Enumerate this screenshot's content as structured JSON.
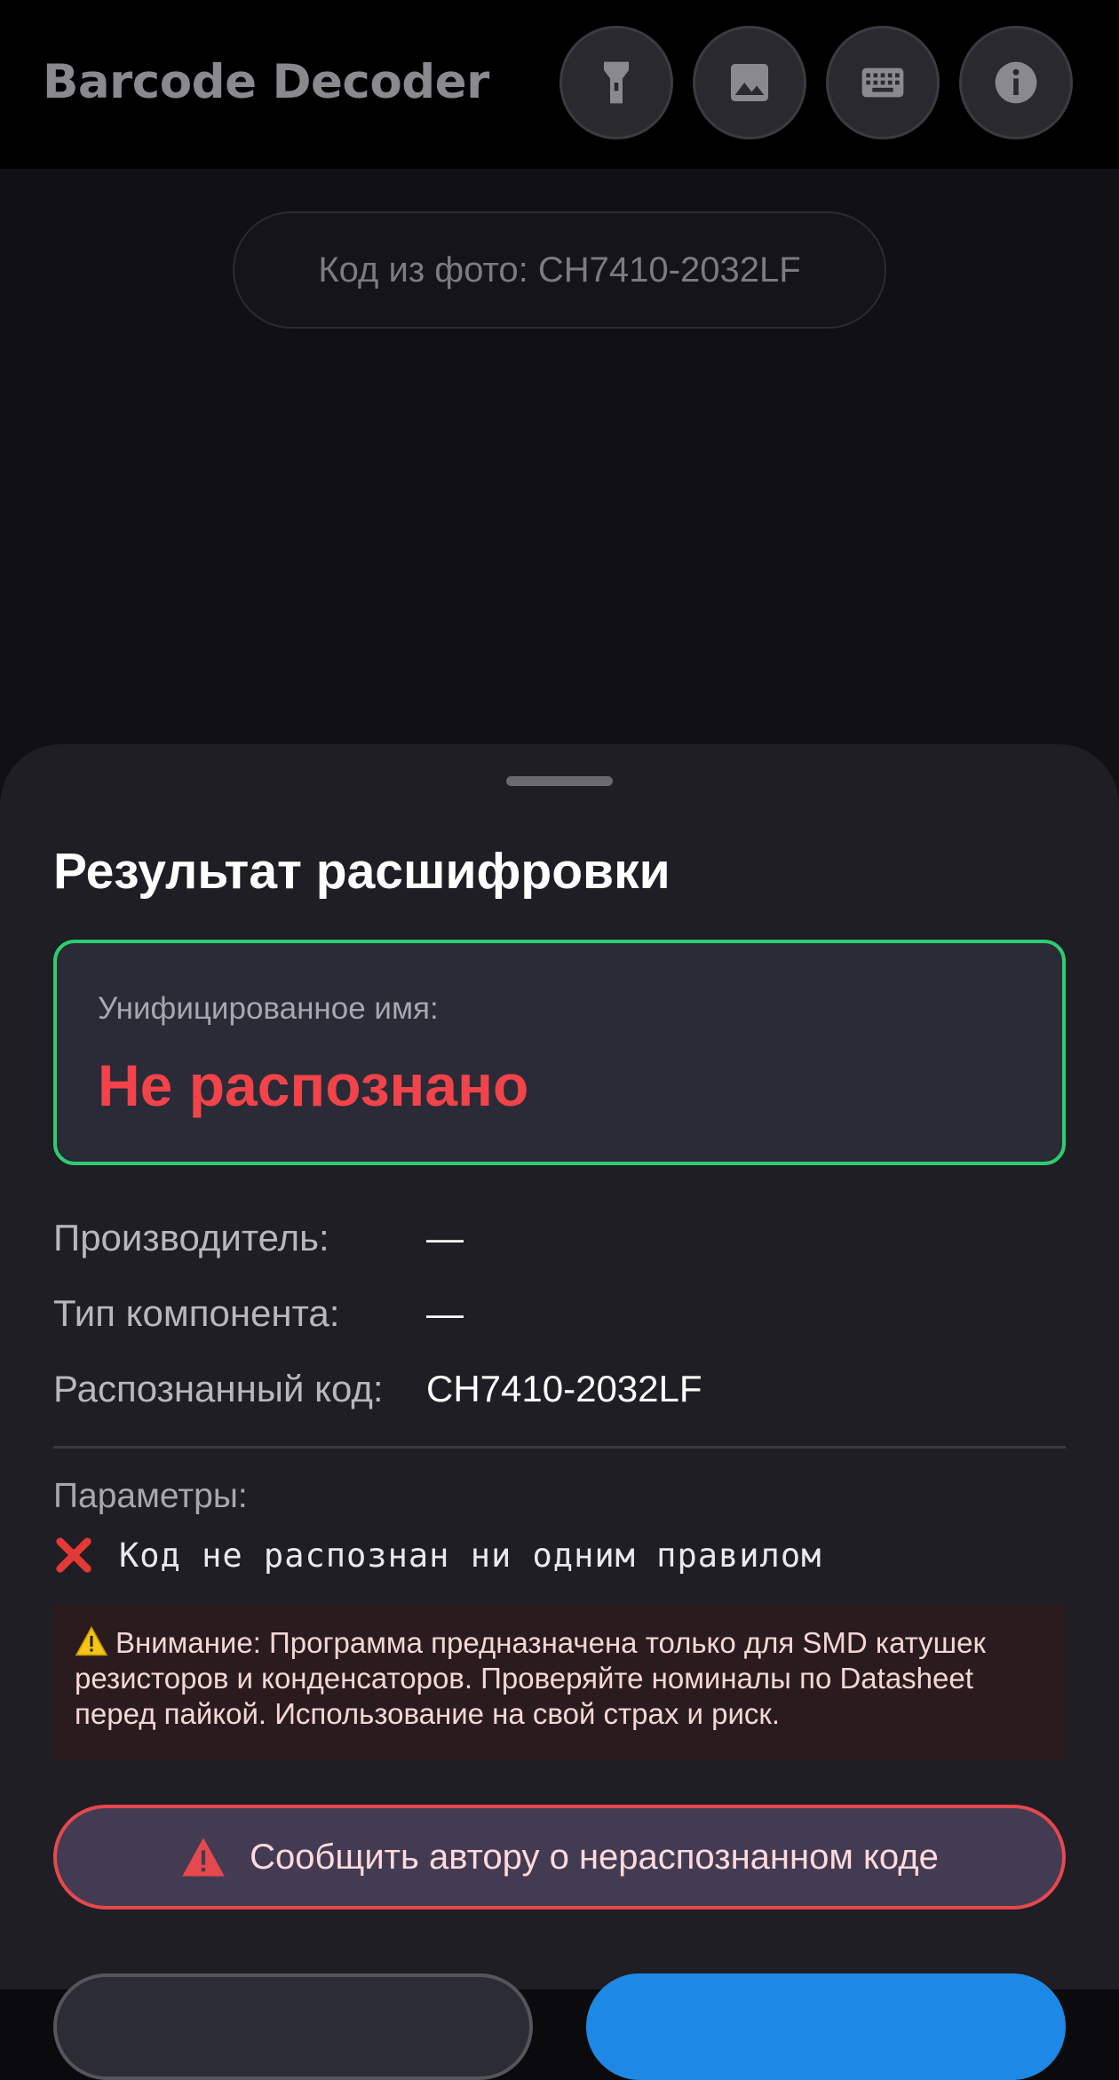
{
  "app": {
    "title": "Barcode Decoder"
  },
  "toolbar": {
    "buttons": [
      {
        "name": "flashlight",
        "icon": "flashlight-icon"
      },
      {
        "name": "gallery",
        "icon": "image-icon"
      },
      {
        "name": "keyboard",
        "icon": "keyboard-icon"
      },
      {
        "name": "info",
        "icon": "info-icon"
      }
    ]
  },
  "camera": {
    "photo_code_label": "Код из фото: CH7410-2032LF"
  },
  "sheet": {
    "title": "Результат расшифровки",
    "unified": {
      "label": "Унифицированное имя:",
      "value": "Не распознано"
    },
    "rows": [
      {
        "label": "Производитель:",
        "value": "—"
      },
      {
        "label": "Тип компонента:",
        "value": "—"
      },
      {
        "label": "Распознанный код:",
        "value": "CH7410-2032LF"
      }
    ],
    "params_label": "Параметры:",
    "param_error": "Код не распознан ни одним правилом",
    "warning": "Внимание: Программа предназначена только для SMD катушек резисторов и конденсаторов. Проверяйте номиналы по Datasheet перед пайкой. Использование на свой страх и риск.",
    "report_button": "Сообщить автору о нераспознанном коде"
  },
  "colors": {
    "accent_green": "#2ecc71",
    "error_red": "#f2434a",
    "primary_blue": "#1e88e5"
  }
}
